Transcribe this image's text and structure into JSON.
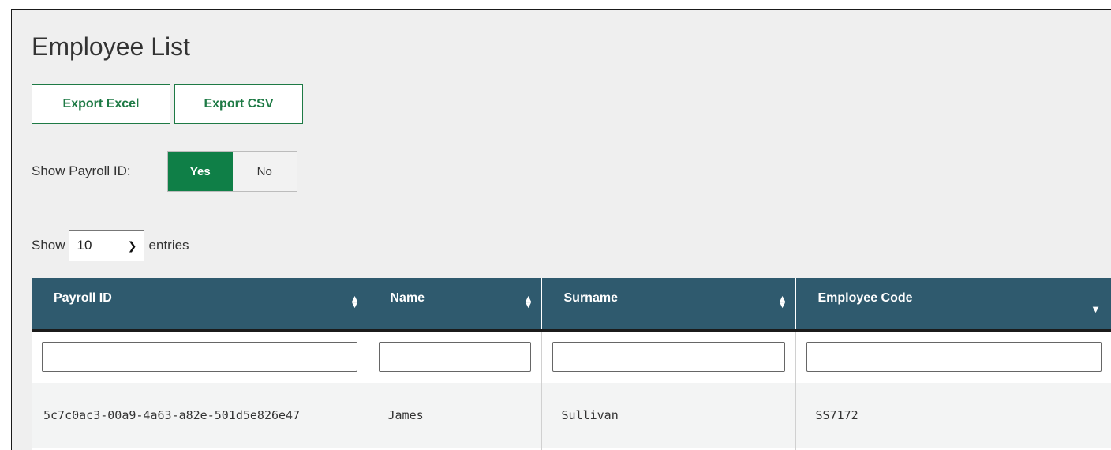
{
  "page": {
    "title": "Employee List"
  },
  "toolbar": {
    "export_excel": "Export Excel",
    "export_csv": "Export CSV"
  },
  "payroll_toggle": {
    "label": "Show Payroll ID:",
    "yes": "Yes",
    "no": "No",
    "selected": "Yes"
  },
  "length": {
    "show": "Show",
    "value": "10",
    "entries": "entries"
  },
  "table": {
    "columns": [
      "Payroll ID",
      "Name",
      "Surname",
      "Employee Code"
    ],
    "rows": [
      [
        "5c7c0ac3-00a9-4a63-a82e-501d5e826e47",
        "James",
        "Sullivan",
        "SS7172"
      ]
    ]
  },
  "colors": {
    "accent": "#0f7f47",
    "header": "#2f5a6e"
  }
}
